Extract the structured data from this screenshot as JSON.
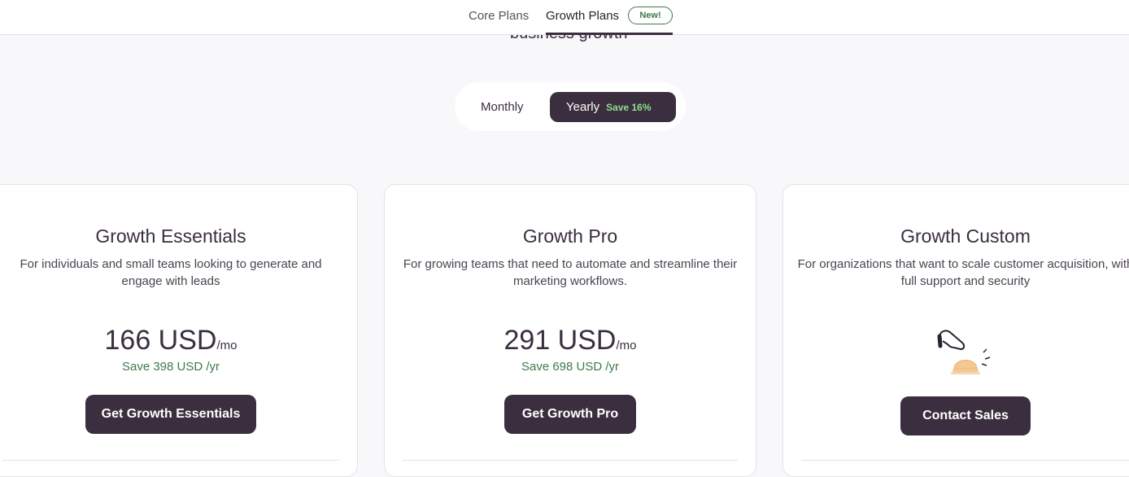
{
  "nav": {
    "tabs": [
      {
        "label": "Core Plans"
      },
      {
        "label": "Growth Plans"
      }
    ],
    "badge": "New!"
  },
  "header": {
    "partial_title": "business growth"
  },
  "billing_toggle": {
    "monthly": "Monthly",
    "yearly": "Yearly",
    "save": "Save 16%",
    "selected": "Yearly"
  },
  "plans": [
    {
      "name": "Growth Essentials",
      "description": "For individuals and small teams looking to generate and engage with leads",
      "price": "166 USD",
      "per": "/mo",
      "savings": "Save 398 USD /yr",
      "cta": "Get Growth Essentials"
    },
    {
      "name": "Growth Pro",
      "description": "For growing teams that need to automate and streamline their marketing workflows.",
      "price": "291 USD",
      "per": "/mo",
      "savings": "Save 698 USD /yr",
      "cta": "Get Growth Pro"
    },
    {
      "name": "Growth Custom",
      "description": "For organizations that want to scale customer acquisition, with full support and security",
      "icon": "service-bell-icon",
      "cta": "Contact Sales"
    }
  ],
  "colors": {
    "accent_dark": "#3b2f3f",
    "save_green": "#3e7a4a",
    "save_light_green": "#8fdc8f"
  }
}
